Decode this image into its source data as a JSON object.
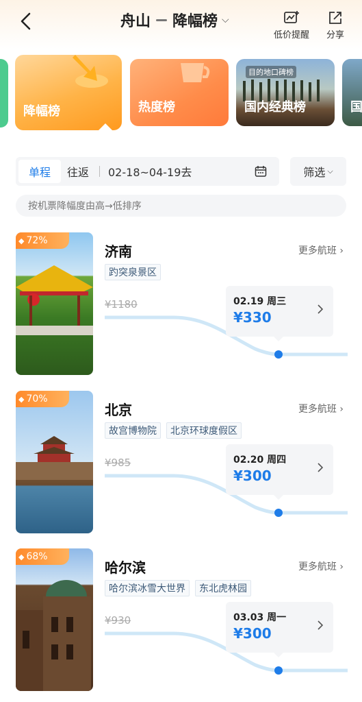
{
  "header": {
    "origin": "舟山",
    "title": "降幅榜",
    "alert_label": "低价提醒",
    "share_label": "分享"
  },
  "categories": [
    {
      "label": "降幅榜",
      "active": true
    },
    {
      "label": "热度榜",
      "active": false
    },
    {
      "label": "国内经典榜",
      "active": false,
      "tag": "目的地口碑榜"
    },
    {
      "label": "国",
      "active": false
    }
  ],
  "filter": {
    "one_way": "单程",
    "round_trip": "往返",
    "date_range": "02-18~04-19去",
    "filter_label": "筛选",
    "sort_hint": "按机票降幅度由高→低排序"
  },
  "destinations": [
    {
      "city": "济南",
      "drop": "72%",
      "more": "更多航班",
      "tags": [
        "趵突泉景区"
      ],
      "old_price": "¥1180",
      "date": "02.19 周三",
      "price": "¥330"
    },
    {
      "city": "北京",
      "drop": "70%",
      "more": "更多航班",
      "tags": [
        "故宫博物院",
        "北京环球度假区"
      ],
      "old_price": "¥985",
      "date": "02.20 周四",
      "price": "¥300"
    },
    {
      "city": "哈尔滨",
      "drop": "68%",
      "more": "更多航班",
      "tags": [
        "哈尔滨冰雪大世界",
        "东北虎林园"
      ],
      "old_price": "¥930",
      "date": "03.03 周一",
      "price": "¥300"
    }
  ],
  "colors": {
    "accent": "#1e7ce8",
    "badge": "#ff8a2b",
    "trend_line": "#bfe0f5",
    "dot": "#1e7ce8"
  }
}
